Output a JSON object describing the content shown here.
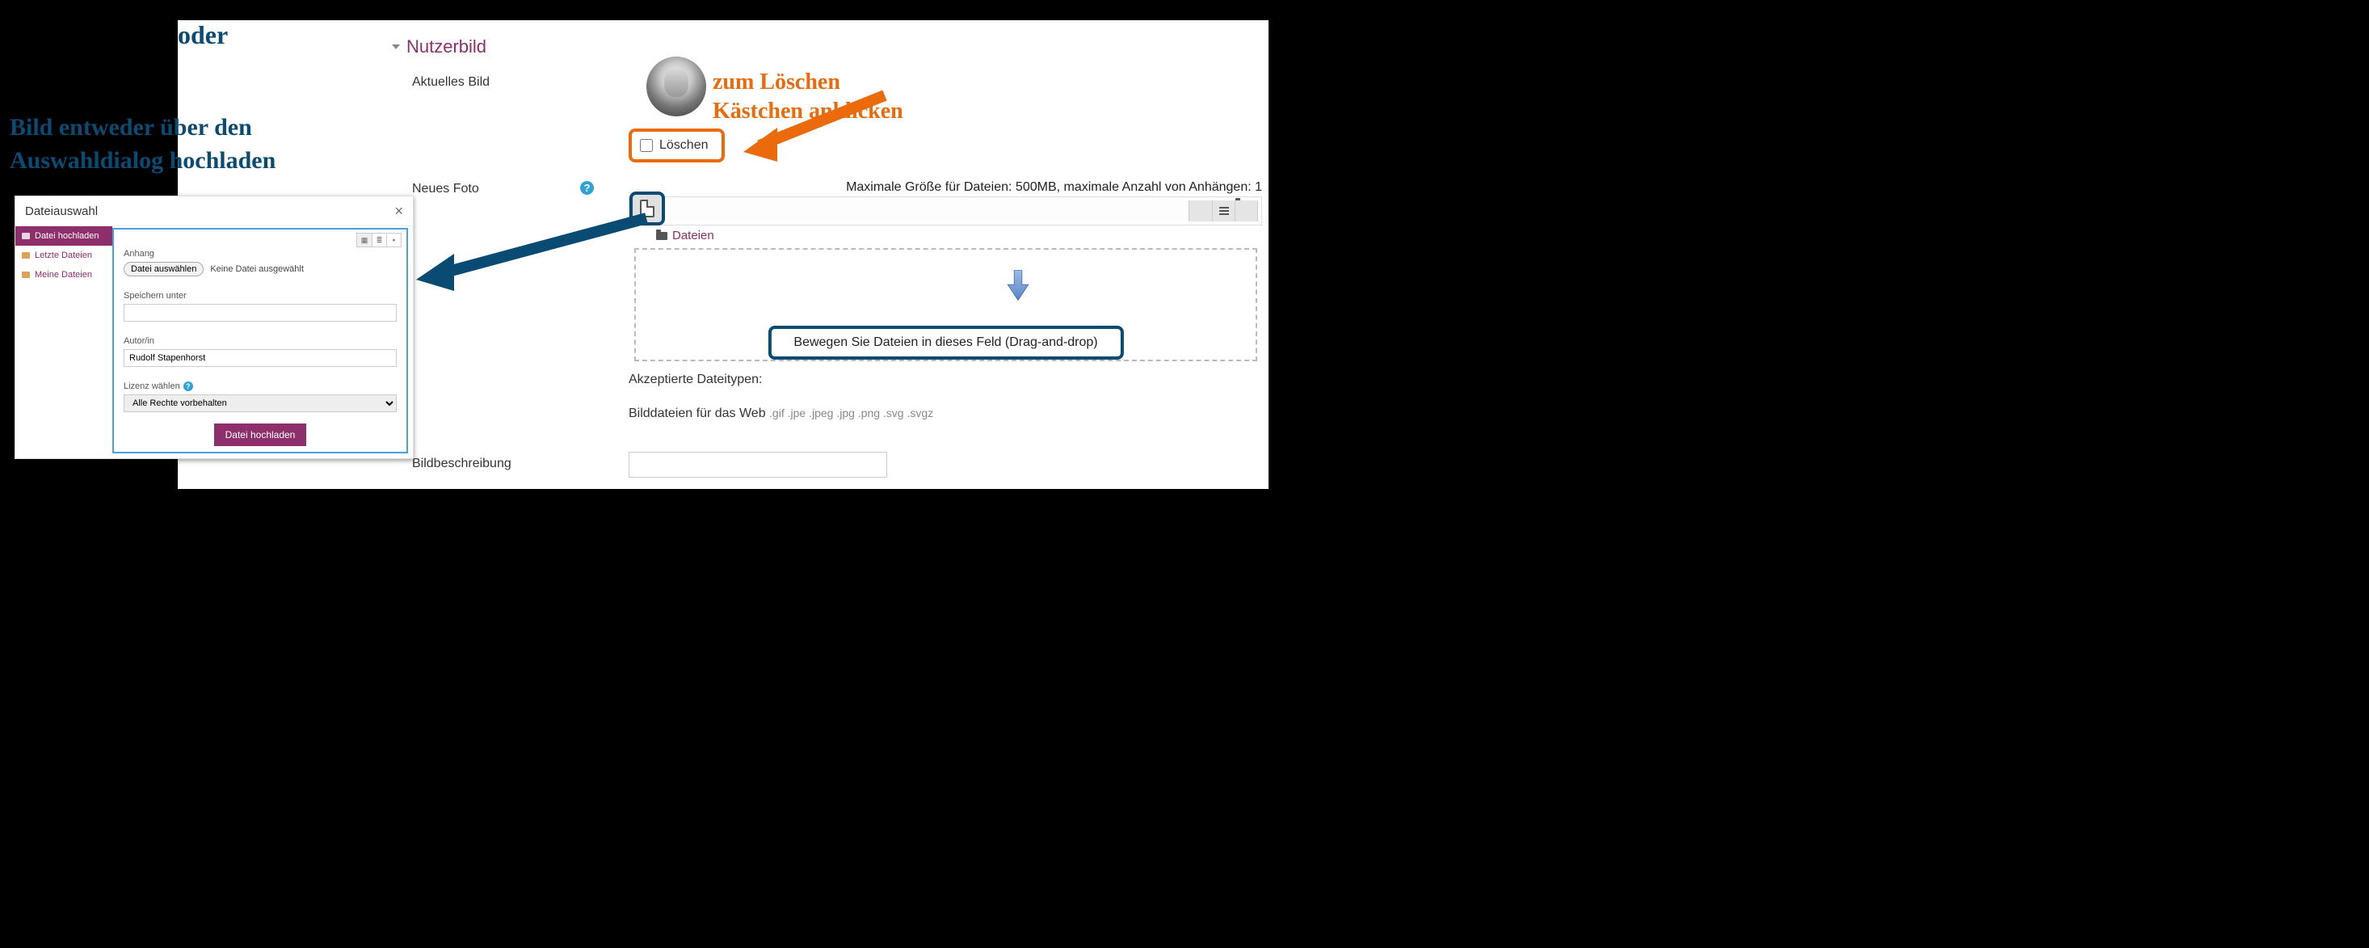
{
  "section": {
    "title": "Nutzerbild",
    "aktuelles_label": "Aktuelles Bild",
    "delete_label": "Löschen",
    "neues_label": "Neues Foto",
    "file_limits": "Maximale Größe für Dateien: 500MB, maximale Anzahl von Anhängen: 1",
    "files_label": "Dateien",
    "drop_hint": "Bewegen Sie Dateien in dieses Feld (Drag-and-drop)",
    "accepted_label": "Akzeptierte Dateitypen:",
    "accepted_types_prefix": "Bilddateien für das Web",
    "accepted_types_ext": ".gif .jpe .jpeg .jpg .png .svg .svgz",
    "desc_label": "Bildbeschreibung"
  },
  "dialog": {
    "title": "Dateiauswahl",
    "side": {
      "upload": "Datei hochladen",
      "recent": "Letzte Dateien",
      "mine": "Meine Dateien"
    },
    "anhang_label": "Anhang",
    "choose_btn": "Datei auswählen",
    "no_file": "Keine Datei ausgewählt",
    "save_as_label": "Speichern unter",
    "save_as_value": "",
    "author_label": "Autor/in",
    "author_value": "Rudolf Stapenhorst",
    "license_label": "Lizenz wählen",
    "license_value": "Alle Rechte vorbehalten",
    "upload_btn": "Datei hochladen"
  },
  "annotations": {
    "blue": "Bild entweder über den\nAuswahldialog hochladen",
    "orange": "zum Löschen\nKästchen anklicken",
    "oder": "oder"
  }
}
